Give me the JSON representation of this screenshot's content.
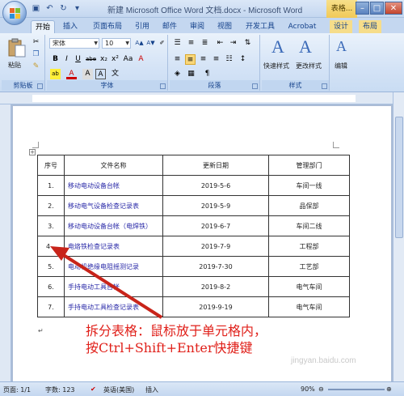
{
  "window": {
    "title": "新建 Microsoft Office Word 文档.docx - Microsoft Word",
    "context_tab": "表格...",
    "qat": [
      "save-icon",
      "undo-icon",
      "redo-icon",
      "customize-icon"
    ]
  },
  "tabs": [
    "开始",
    "插入",
    "页面布局",
    "引用",
    "邮件",
    "审阅",
    "视图",
    "开发工具",
    "Acrobat",
    "设计",
    "布局"
  ],
  "ribbon": {
    "clipboard": {
      "paste": "粘贴",
      "label": "剪贴板"
    },
    "font": {
      "name": "宋体",
      "size": "10",
      "label": "字体",
      "bold": "B",
      "italic": "I",
      "underline": "U",
      "strike": "abe",
      "sub": "x₂",
      "sup": "x²",
      "aa": "Aa",
      "change_case": "A",
      "highlight": "ab",
      "font_color": "A",
      "char_border": "A",
      "wen": "文"
    },
    "paragraph": {
      "label": "段落"
    },
    "styles": {
      "quick": "快速样式",
      "change": "更改样式",
      "label": "样式",
      "icon_text": "A"
    },
    "editing": {
      "label": "编辑"
    }
  },
  "table": {
    "headers": [
      "序号",
      "文件名称",
      "更新日期",
      "管理部门"
    ],
    "rows": [
      [
        "1.",
        "移动电动设备台帐",
        "2019-5-6",
        "车间一线"
      ],
      [
        "2.",
        "移动电气设备检查记录表",
        "2019-5-9",
        "品保部"
      ],
      [
        "3.",
        "移动电动设备台帐（电焊铁）",
        "2019-6-7",
        "车间二线"
      ],
      [
        "4",
        "电烙铁检查记录表",
        "2019-7-9",
        "工程部"
      ],
      [
        "5.",
        "电动机绝缘电阻摇测记录",
        "2019-7-30",
        "工艺部"
      ],
      [
        "6.",
        "手持电动工具台帐",
        "2019-8-2",
        "电气车间"
      ],
      [
        "7.",
        "手持电动工具检查记录表",
        "2019-9-19",
        "电气车间"
      ]
    ]
  },
  "annotation": {
    "line1": "拆分表格：鼠标放于单元格内，",
    "line2": "按Ctrl+Shift+Enter快捷键"
  },
  "watermark": "jingyan.baidu.com",
  "status": {
    "page": "页面: 1/1",
    "words": "字数: 123",
    "language": "英语(美国)",
    "mode": "插入",
    "zoom": "90%"
  },
  "colors": {
    "annotation": "#e0201a",
    "arrow": "#c8241a",
    "link_text": "#2a2aa8"
  }
}
